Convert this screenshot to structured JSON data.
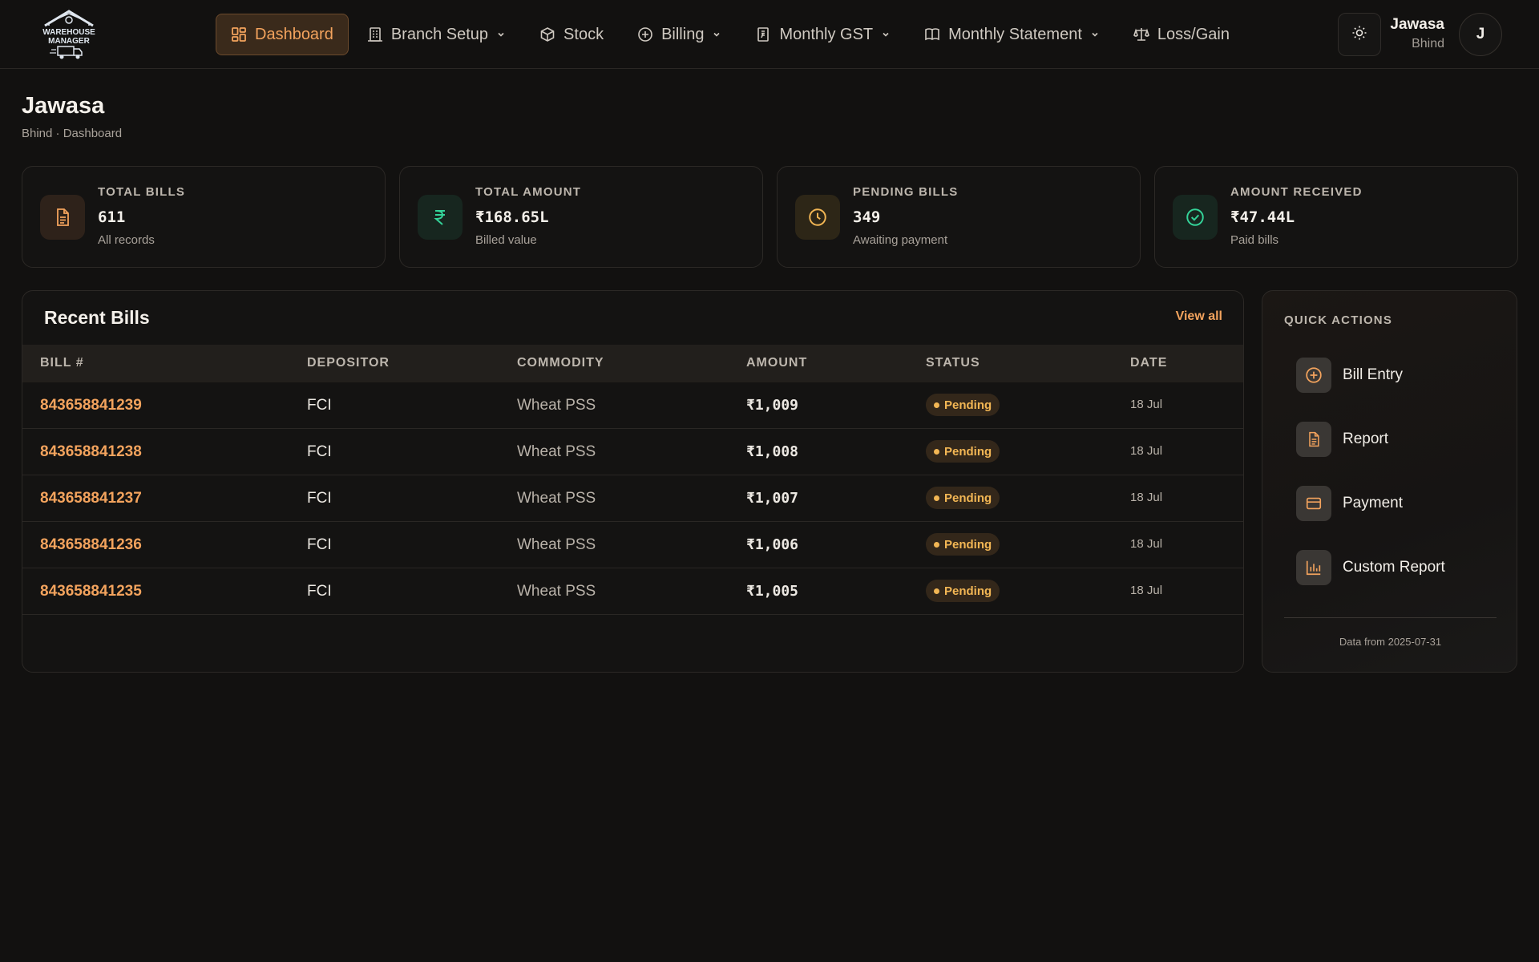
{
  "app": {
    "logo_line1": "WAREHOUSE",
    "logo_line2": "MANAGER"
  },
  "nav": {
    "items": [
      {
        "label": "Dashboard",
        "icon": "dashboard-icon",
        "active": true
      },
      {
        "label": "Branch Setup",
        "icon": "building-icon",
        "dropdown": true
      },
      {
        "label": "Stock",
        "icon": "box-icon"
      },
      {
        "label": "Billing",
        "icon": "plus-circle-icon",
        "dropdown": true
      },
      {
        "label": "Monthly GST",
        "icon": "receipt-icon",
        "dropdown": true
      },
      {
        "label": "Monthly Statement",
        "icon": "book-icon",
        "dropdown": true
      },
      {
        "label": "Loss/Gain",
        "icon": "scale-icon"
      }
    ]
  },
  "user": {
    "name": "Jawasa",
    "branch": "Bhind",
    "initial": "J"
  },
  "page": {
    "title": "Jawasa",
    "breadcrumb": "Bhind · Dashboard"
  },
  "stats": [
    {
      "label": "Total Bills",
      "value": "611",
      "sub": "All records",
      "icon": "document-icon",
      "accent": "#f3a35d"
    },
    {
      "label": "Total Amount",
      "value": "₹168.65L",
      "sub": "Billed value",
      "icon": "rupee-icon",
      "accent": "#34d399"
    },
    {
      "label": "Pending Bills",
      "value": "349",
      "sub": "Awaiting payment",
      "icon": "clock-icon",
      "accent": "#f2b654"
    },
    {
      "label": "Amount Received",
      "value": "₹47.44L",
      "sub": "Paid bills",
      "icon": "check-circle-icon",
      "accent": "#34d399"
    }
  ],
  "bills": {
    "title": "Recent Bills",
    "view_all": "View all",
    "columns": [
      "Bill #",
      "Depositor",
      "Commodity",
      "Amount",
      "Status",
      "Date"
    ],
    "rows": [
      {
        "bill": "843658841239",
        "depositor": "FCI",
        "commodity": "Wheat PSS",
        "amount": "₹1,009",
        "status": "Pending",
        "date": "18 Jul"
      },
      {
        "bill": "843658841238",
        "depositor": "FCI",
        "commodity": "Wheat PSS",
        "amount": "₹1,008",
        "status": "Pending",
        "date": "18 Jul"
      },
      {
        "bill": "843658841237",
        "depositor": "FCI",
        "commodity": "Wheat PSS",
        "amount": "₹1,007",
        "status": "Pending",
        "date": "18 Jul"
      },
      {
        "bill": "843658841236",
        "depositor": "FCI",
        "commodity": "Wheat PSS",
        "amount": "₹1,006",
        "status": "Pending",
        "date": "18 Jul"
      },
      {
        "bill": "843658841235",
        "depositor": "FCI",
        "commodity": "Wheat PSS",
        "amount": "₹1,005",
        "status": "Pending",
        "date": "18 Jul"
      }
    ]
  },
  "quick_actions": {
    "title": "Quick Actions",
    "items": [
      {
        "label": "Bill Entry",
        "icon": "plus-circle-icon"
      },
      {
        "label": "Report",
        "icon": "document-icon"
      },
      {
        "label": "Payment",
        "icon": "credit-card-icon"
      },
      {
        "label": "Custom Report",
        "icon": "bar-chart-icon"
      }
    ],
    "footer": "Data from 2025-07-31"
  },
  "colors": {
    "accent": "#f3a35d",
    "success": "#34d399",
    "warning": "#f2b654",
    "background": "#121110"
  }
}
